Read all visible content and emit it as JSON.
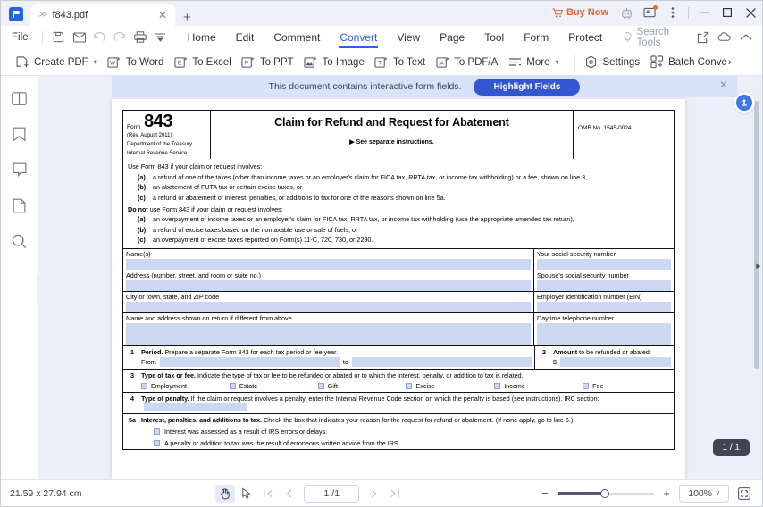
{
  "titlebar": {
    "logo_icon": "pdfelement-logo-icon",
    "tab": {
      "name": "f843.pdf",
      "chevron_icon": "chevron-double-down-icon",
      "close_icon": "close-icon"
    },
    "new_tab_icon": "plus-icon",
    "buy_now": "Buy Now",
    "buy_now_icon": "cart-icon",
    "buy_now_color": "#e8612c",
    "ai_icon": "ai-robot-icon",
    "feedback_icon": "feedback-icon",
    "more_icon": "more-vertical-icon",
    "minimize_icon": "minimize-icon",
    "maximize_icon": "maximize-icon",
    "close_window_icon": "close-window-icon"
  },
  "menubar": {
    "file": "File",
    "quick_icons": [
      "save-icon",
      "email-icon",
      "undo-icon",
      "redo-icon",
      "print-icon",
      "dropdown-icon"
    ],
    "items": [
      {
        "label": "Home",
        "active": false
      },
      {
        "label": "Edit",
        "active": false
      },
      {
        "label": "Comment",
        "active": false
      },
      {
        "label": "Convert",
        "active": true
      },
      {
        "label": "View",
        "active": false
      },
      {
        "label": "Page",
        "active": false
      },
      {
        "label": "Tool",
        "active": false
      },
      {
        "label": "Form",
        "active": false
      },
      {
        "label": "Protect",
        "active": false
      }
    ],
    "search": {
      "placeholder": "Search Tools",
      "icon": "lightbulb-icon"
    },
    "right_icons": [
      "share-icon",
      "cloud-icon",
      "collapse-ribbon-icon"
    ],
    "active_color": "#2463eb"
  },
  "ribbon": {
    "buttons": [
      {
        "label": "Create PDF",
        "icon": "create-pdf-icon",
        "caret": true
      },
      {
        "label": "To Word",
        "icon": "to-word-icon",
        "caret": false
      },
      {
        "label": "To Excel",
        "icon": "to-excel-icon",
        "caret": false
      },
      {
        "label": "To PPT",
        "icon": "to-ppt-icon",
        "caret": false
      },
      {
        "label": "To Image",
        "icon": "to-image-icon",
        "caret": false
      },
      {
        "label": "To Text",
        "icon": "to-text-icon",
        "caret": false
      },
      {
        "label": "To PDF/A",
        "icon": "to-pdfa-icon",
        "caret": false
      },
      {
        "label": "More",
        "icon": "more-lines-icon",
        "caret": true
      }
    ],
    "settings": {
      "label": "Settings",
      "icon": "settings-gear-icon"
    },
    "batch": {
      "label": "Batch Conve",
      "icon": "batch-convert-icon",
      "overflow": "›"
    }
  },
  "leftrail": {
    "items": [
      {
        "name": "thumbnails-panel",
        "icon": "thumbnails-icon"
      },
      {
        "name": "bookmarks-panel",
        "icon": "bookmark-icon"
      },
      {
        "name": "comments-panel",
        "icon": "comment-icon"
      },
      {
        "name": "attachments-panel",
        "icon": "attachment-page-icon"
      },
      {
        "name": "search-panel",
        "icon": "search-icon"
      }
    ],
    "expand_icon": "expand-panel-icon"
  },
  "notification": {
    "text": "This document contains interactive form fields.",
    "button": "Highlight Fields",
    "close_icon": "close-icon",
    "bg_color": "#d8e2fb",
    "button_color": "#3257d0"
  },
  "viewer": {
    "upload_icon": "upload-cloud-icon",
    "page_pill": "1 / 1",
    "expand_icon": "expand-right-icon"
  },
  "document": {
    "header": {
      "form_word": "Form",
      "form_number": "843",
      "rev": "(Rev. August 2011)",
      "dept1": "Department of the Treasury",
      "dept2": "Internal Revenue Service",
      "title": "Claim for Refund and Request for Abatement",
      "see_instructions": "▶ See separate instructions.",
      "omb": "OMB No. 1545-0024"
    },
    "use_intro": "Use Form 843 if your claim or request involves:",
    "use_items": [
      {
        "label": "(a)",
        "text": "a refund of one of the taxes (other than income taxes or an employer's claim for FICA tax, RRTA tax, or income tax withholding) or a fee, shown on line 3,"
      },
      {
        "label": "(b)",
        "text": "an abatement of FUTA tax or certain excise taxes, or"
      },
      {
        "label": "(c)",
        "text": "a refund or abatement of interest, penalties, or additions to tax for one of the reasons shown on line 5a."
      }
    ],
    "donot_intro_bold": "Do not",
    "donot_intro_rest": " use Form 843 if your claim or request involves:",
    "donot_items": [
      {
        "label": "(a)",
        "text": "an overpayment of income taxes or an employer's claim for FICA tax, RRTA tax, or income tax withholding (use the appropriate amended tax return),"
      },
      {
        "label": "(b)",
        "text": "a refund of excise taxes based on the nontaxable use or sale of fuels, or"
      },
      {
        "label": "(c)",
        "text": "an overpayment of excise taxes reported on Form(s) 11-C, 720, 730, or 2290."
      }
    ],
    "field_rows": [
      {
        "left": "Name(s)",
        "right": "Your social security number"
      },
      {
        "left": "Address (number, street, and room or suite no.)",
        "right": "Spouse's social security number"
      },
      {
        "left": "City or town, state, and ZIP code",
        "right": "Employer identification number (EIN)"
      },
      {
        "left": "Name and address shown on return if different from above",
        "right": "Daytime telephone number"
      }
    ],
    "line1": {
      "num": "1",
      "bold": "Period.",
      "text": " Prepare a separate Form 843 for each tax period or fee year.",
      "from": "From",
      "to": "to"
    },
    "line2": {
      "num": "2",
      "bold": "Amount",
      "text": " to be refunded or abated:",
      "dollar": "$"
    },
    "line3": {
      "num": "3",
      "bold": "Type of tax or fee.",
      "text": " Indicate the type of tax or fee to be refunded or abated or to which the interest, penalty, or addition to tax is related.",
      "checkboxes": [
        "Employment",
        "Estate",
        "Gift",
        "Excise",
        "Income",
        "Fee"
      ]
    },
    "line4": {
      "num": "4",
      "bold": "Type of penalty.",
      "text": " If the claim or request involves a penalty, enter the Internal Revenue Code section on which the penalty is based (see instructions). IRC section:"
    },
    "line5a": {
      "num": "5a",
      "bold": "Interest, penalties, and additions to tax.",
      "text": " Check the box that indicates your reason for the request for refund or abatement. (If none apply, go to line 6.)",
      "options": [
        "Interest was assessed as a result of IRS errors or delays.",
        "A penalty or addition to tax was the result of erroneous written advice from the IRS."
      ]
    },
    "field_highlight_color": "#ccd8f2"
  },
  "statusbar": {
    "dimensions": "21.59 x 27.94 cm",
    "tools": [
      {
        "name": "hand-tool",
        "icon": "hand-icon",
        "selected": true
      },
      {
        "name": "select-tool",
        "icon": "cursor-arrow-icon",
        "selected": false
      }
    ],
    "nav": {
      "first_icon": "first-page-icon",
      "prev_icon": "prev-page-icon",
      "page_value": "1 /1",
      "next_icon": "next-page-icon",
      "last_icon": "last-page-icon"
    },
    "zoom": {
      "minus": "−",
      "plus": "+",
      "level": "100%",
      "caret": "⌄",
      "fit_icon": "fit-page-icon"
    }
  }
}
